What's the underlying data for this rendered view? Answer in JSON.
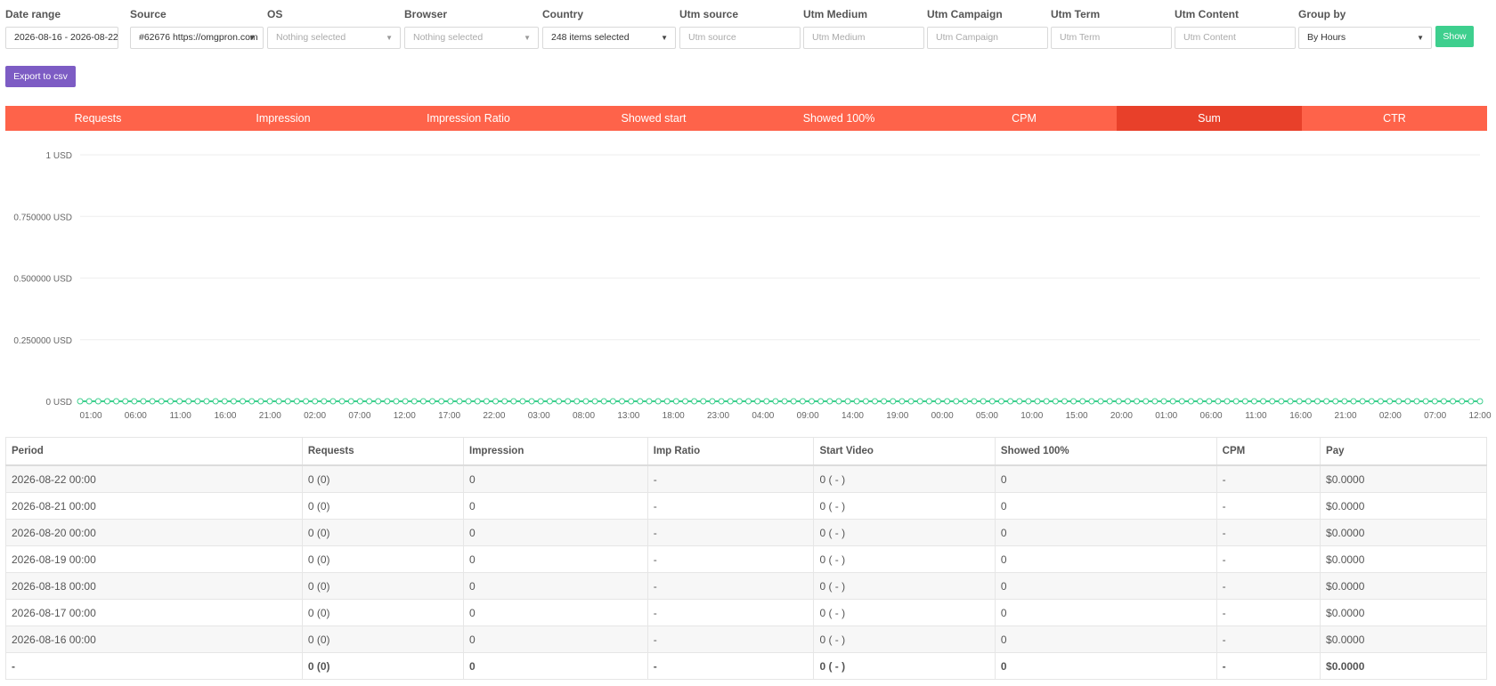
{
  "filters": {
    "date_range": {
      "label": "Date range",
      "value": "2026-08-16 - 2026-08-22"
    },
    "source": {
      "label": "Source",
      "value": "#62676 https://omgpron.com"
    },
    "os": {
      "label": "OS",
      "value": "Nothing selected"
    },
    "browser": {
      "label": "Browser",
      "value": "Nothing selected"
    },
    "country": {
      "label": "Country",
      "value": "248 items selected"
    },
    "utm_source": {
      "label": "Utm source",
      "placeholder": "Utm source"
    },
    "utm_medium": {
      "label": "Utm Medium",
      "placeholder": "Utm Medium"
    },
    "utm_campaign": {
      "label": "Utm Campaign",
      "placeholder": "Utm Campaign"
    },
    "utm_term": {
      "label": "Utm Term",
      "placeholder": "Utm Term"
    },
    "utm_content": {
      "label": "Utm Content",
      "placeholder": "Utm Content"
    },
    "group_by": {
      "label": "Group by",
      "value": "By Hours"
    }
  },
  "buttons": {
    "show": "Show",
    "export": "Export to csv"
  },
  "tabs": [
    {
      "label": "Requests",
      "active": false
    },
    {
      "label": "Impression",
      "active": false
    },
    {
      "label": "Impression Ratio",
      "active": false
    },
    {
      "label": "Showed start",
      "active": false
    },
    {
      "label": "Showed 100%",
      "active": false
    },
    {
      "label": "CPM",
      "active": false
    },
    {
      "label": "Sum",
      "active": true
    },
    {
      "label": "CTR",
      "active": false
    }
  ],
  "chart_data": {
    "type": "line",
    "title": "",
    "xlabel": "",
    "ylabel": "",
    "ylim": [
      0,
      1
    ],
    "y_ticks": [
      "1 USD",
      "0.750000 USD",
      "0.500000 USD",
      "0.250000 USD",
      "0 USD"
    ],
    "x_ticks": [
      "01:00",
      "06:00",
      "11:00",
      "16:00",
      "21:00",
      "02:00",
      "07:00",
      "12:00",
      "17:00",
      "22:00",
      "03:00",
      "08:00",
      "13:00",
      "18:00",
      "23:00",
      "04:00",
      "09:00",
      "14:00",
      "19:00",
      "00:00",
      "05:00",
      "10:00",
      "15:00",
      "20:00",
      "01:00",
      "06:00",
      "11:00",
      "16:00",
      "21:00",
      "02:00",
      "07:00",
      "12:00"
    ],
    "grid": true,
    "colors": {
      "line": "#3ecf8e"
    },
    "series": [
      {
        "point_count": 156,
        "value": 0
      }
    ]
  },
  "table": {
    "headers": [
      "Period",
      "Requests",
      "Impression",
      "Imp Ratio",
      "Start Video",
      "Showed 100%",
      "CPM",
      "Pay"
    ],
    "rows": [
      [
        "2026-08-22 00:00",
        "0 (0)",
        "0",
        "-",
        "0 ( - )",
        "0",
        "-",
        "$0.0000"
      ],
      [
        "2026-08-21 00:00",
        "0 (0)",
        "0",
        "-",
        "0 ( - )",
        "0",
        "-",
        "$0.0000"
      ],
      [
        "2026-08-20 00:00",
        "0 (0)",
        "0",
        "-",
        "0 ( - )",
        "0",
        "-",
        "$0.0000"
      ],
      [
        "2026-08-19 00:00",
        "0 (0)",
        "0",
        "-",
        "0 ( - )",
        "0",
        "-",
        "$0.0000"
      ],
      [
        "2026-08-18 00:00",
        "0 (0)",
        "0",
        "-",
        "0 ( - )",
        "0",
        "-",
        "$0.0000"
      ],
      [
        "2026-08-17 00:00",
        "0 (0)",
        "0",
        "-",
        "0 ( - )",
        "0",
        "-",
        "$0.0000"
      ],
      [
        "2026-08-16 00:00",
        "0 (0)",
        "0",
        "-",
        "0 ( - )",
        "0",
        "-",
        "$0.0000"
      ]
    ],
    "total": [
      "-",
      "0 (0)",
      "0",
      "-",
      "0 ( - )",
      "0",
      "-",
      "$0.0000"
    ]
  },
  "colors": {
    "tab_bar": "#fe634a",
    "tab_active": "#e8402a",
    "show_button": "#3ecf8e",
    "export_button": "#7d5cc4",
    "chart_line": "#3ecf8e"
  }
}
